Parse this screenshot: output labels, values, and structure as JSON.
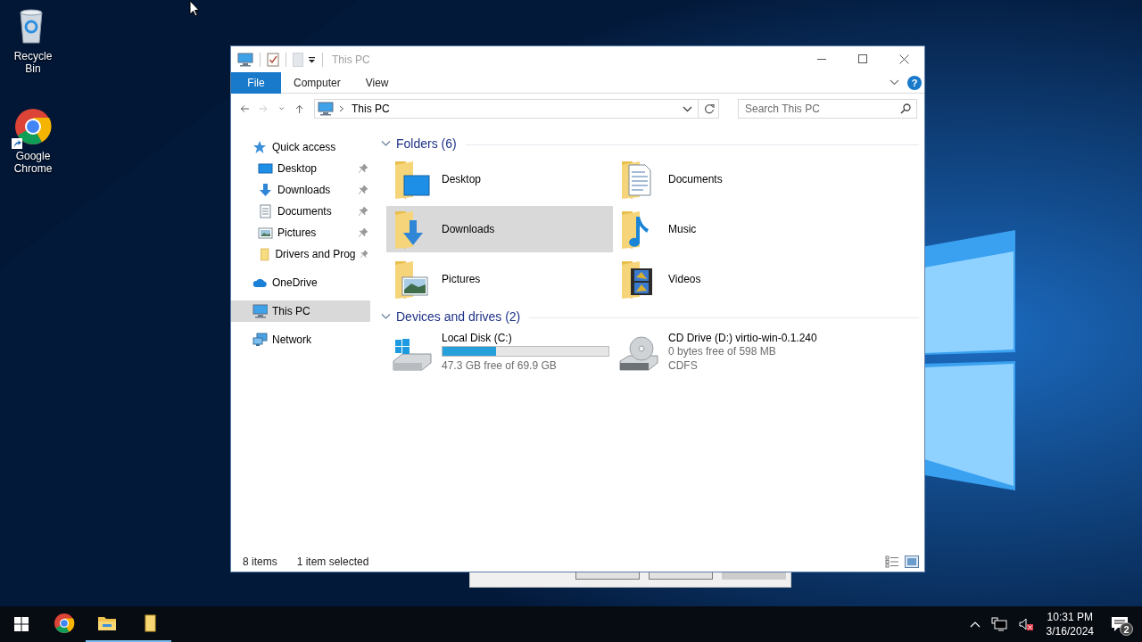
{
  "desktop_icons": [
    {
      "label": "Recycle Bin",
      "kind": "recycle"
    },
    {
      "label": "Google Chrome",
      "kind": "chrome"
    }
  ],
  "window": {
    "title": "This PC",
    "active": false
  },
  "ribbon": {
    "file_tab": "File",
    "tabs": [
      {
        "label": "Computer",
        "selected": false
      },
      {
        "label": "View",
        "selected": false
      }
    ],
    "help": "?"
  },
  "nav_buttons": [
    {
      "kind": "back",
      "disabled": false
    },
    {
      "kind": "forward",
      "disabled": true
    },
    {
      "kind": "recent",
      "disabled": false
    },
    {
      "kind": "up",
      "disabled": false
    }
  ],
  "address": {
    "path": "This PC"
  },
  "search": {
    "placeholder": "Search This PC"
  },
  "nav_pane": [
    {
      "label": "Quick access",
      "kind": "star",
      "selected": false,
      "children": [
        {
          "label": "Desktop",
          "kind": "desktop",
          "pinned": true,
          "selected": false
        },
        {
          "label": "Downloads",
          "kind": "downloads",
          "pinned": true,
          "selected": false
        },
        {
          "label": "Documents",
          "kind": "documents",
          "pinned": true,
          "selected": false
        },
        {
          "label": "Pictures",
          "kind": "pictures",
          "pinned": true,
          "selected": false
        },
        {
          "label": "Drivers and Prog",
          "kind": "folder",
          "pinned": true,
          "selected": false
        }
      ]
    },
    {
      "label": "OneDrive",
      "kind": "cloud",
      "selected": false
    },
    {
      "label": "This PC",
      "kind": "pc",
      "selected": true
    },
    {
      "label": "Network",
      "kind": "network",
      "selected": false
    }
  ],
  "groups": [
    {
      "title": "Folders (6)",
      "expanded": true,
      "items": [
        {
          "name": "Desktop",
          "kind": "desktop",
          "selected": false
        },
        {
          "name": "Documents",
          "kind": "documents",
          "selected": false
        },
        {
          "name": "Downloads",
          "kind": "downloads",
          "selected": true
        },
        {
          "name": "Music",
          "kind": "music",
          "selected": false
        },
        {
          "name": "Pictures",
          "kind": "pictures",
          "selected": false
        },
        {
          "name": "Videos",
          "kind": "videos",
          "selected": false
        }
      ]
    },
    {
      "title": "Devices and drives (2)",
      "expanded": true,
      "items": [
        {
          "name": "Local Disk (C:)",
          "kind": "disk",
          "selected": false,
          "level": 0.32,
          "details": [
            "47.3 GB free of 69.9 GB"
          ]
        },
        {
          "name": "CD Drive (D:) virtio-win-0.1.240",
          "kind": "cd",
          "selected": false,
          "details": [
            "0 bytes free of 598 MB",
            "CDFS"
          ]
        }
      ]
    }
  ],
  "status_bar": {
    "item_count": "8 items",
    "selection": "1 item selected"
  },
  "background_dialog": {
    "buttons": [
      {
        "disabled": false
      },
      {
        "disabled": false
      },
      {
        "disabled": true
      }
    ]
  },
  "taskbar": {
    "apps": [
      {
        "kind": "chrome",
        "running": false
      },
      {
        "kind": "explorer",
        "running": true
      },
      {
        "kind": "notes",
        "running": true
      }
    ],
    "time": "10:31 PM",
    "date": "3/16/2024",
    "notifications": "2",
    "volume_muted": true
  }
}
